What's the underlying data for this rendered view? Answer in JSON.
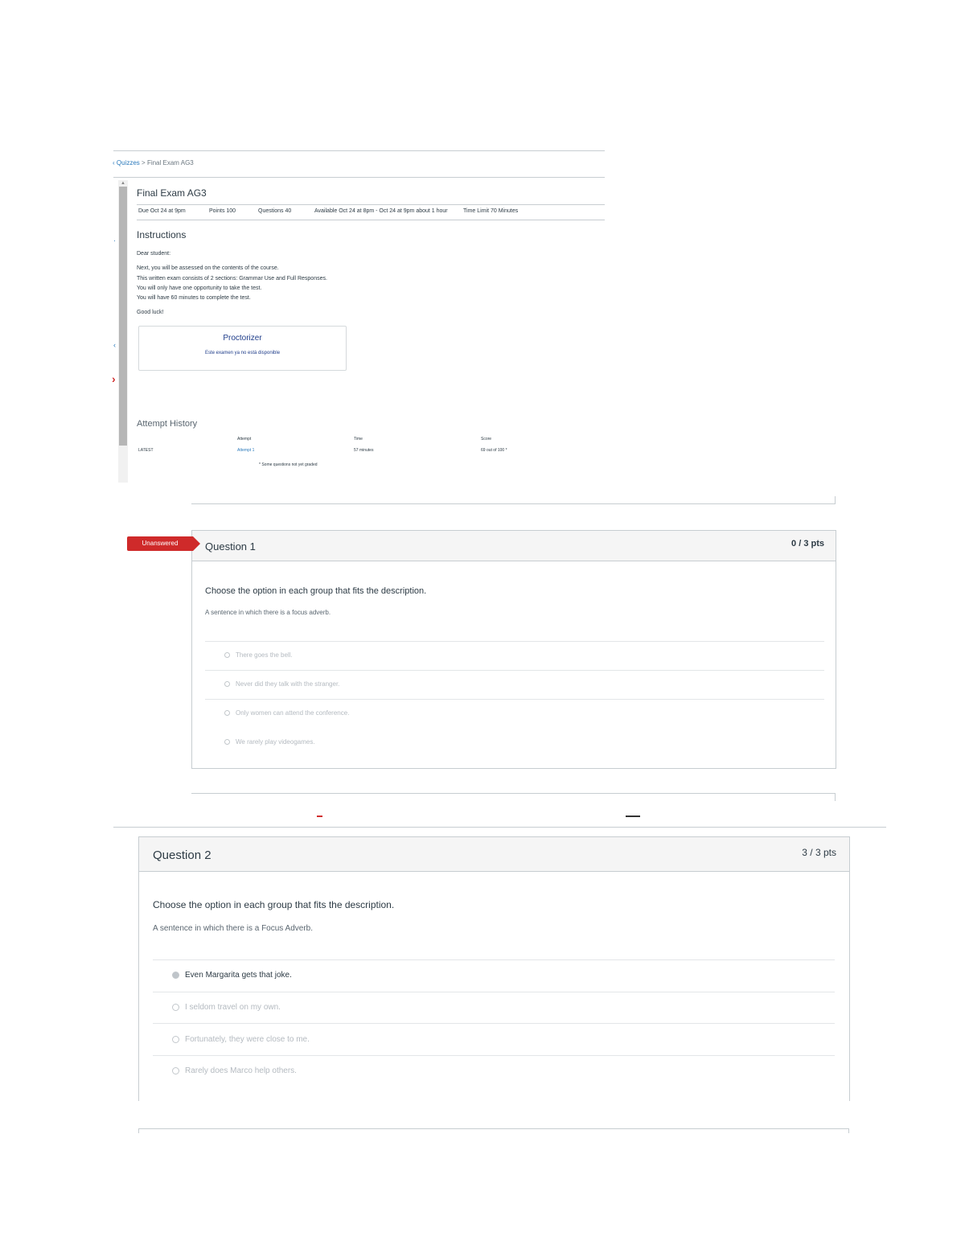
{
  "breadcrumb": {
    "parent": "Quizzes",
    "separator": ">",
    "current": "Final Exam AG3"
  },
  "exam": {
    "title": "Final Exam AG3",
    "meta": {
      "due": "Due Oct 24 at 9pm",
      "points": "Points 100",
      "questions": "Questions 40",
      "available": "Available Oct 24 at 8pm - Oct 24 at 9pm about 1 hour",
      "time_limit": "Time Limit 70 Minutes"
    },
    "instructions_title": "Instructions",
    "instructions": [
      "Dear student:",
      "Next, you will be assessed on the contents of the course.",
      "This written exam consists of 2 sections: Grammar Use and Full Responses.",
      "You will only have one opportunity to take the test.",
      "You will have 60 minutes to complete the test.",
      "Good luck!"
    ],
    "proctorizer": {
      "title": "Proctorizer",
      "subtitle": "Este examen ya no está disponible"
    },
    "attempt_history": {
      "title": "Attempt History",
      "headers": {
        "attempt": "Attempt",
        "time": "Time",
        "score": "Score"
      },
      "row": {
        "label": "LATEST",
        "attempt": "Attempt 1",
        "time": "57 minutes",
        "score": "69 out of 100 *"
      },
      "note": "* Some questions not yet graded"
    }
  },
  "question1": {
    "flag": "Unanswered",
    "title": "Question 1",
    "points": "0 / 3 pts",
    "prompt": "Choose the option in each group that fits the description.",
    "subprompt": "A sentence in which there is a focus adverb.",
    "answers": [
      "There goes the bell.",
      "Never did they talk with the stranger.",
      "Only women can attend the conference.",
      "We rarely play videogames."
    ]
  },
  "question2": {
    "title": "Question 2",
    "points": "3 / 3 pts",
    "prompt": "Choose the option in each group that fits the description.",
    "subprompt": "A sentence in which there is a Focus Adverb.",
    "answers": [
      "Even Margarita gets that joke.",
      "I seldom travel on my own.",
      "Fortunately, they were close to me.",
      "Rarely does Marco help others."
    ],
    "selected_index": 0
  }
}
